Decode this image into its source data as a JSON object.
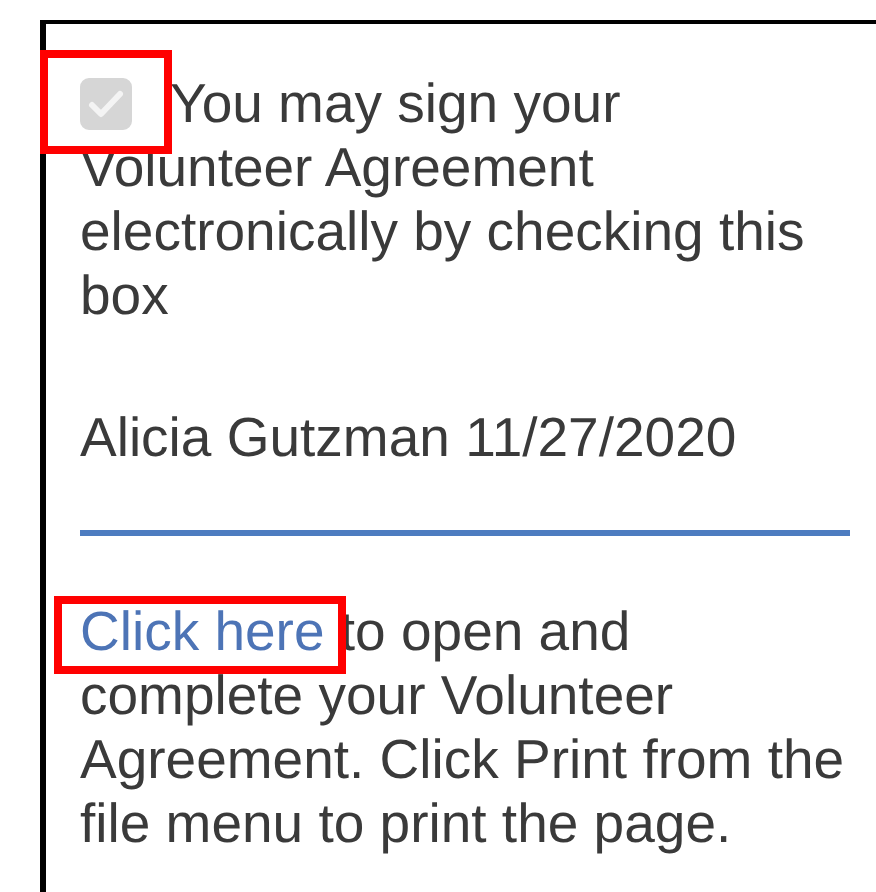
{
  "consent": {
    "checked": true,
    "disabled": true,
    "highlighted": true,
    "label": "You may sign your Volunteer Agreement electronically by checking this box"
  },
  "signature": "Alicia Gutzman 11/27/2020",
  "instructions": {
    "link": {
      "text": "Click here",
      "highlighted": true
    },
    "text": " to open and complete your Volunteer Agreement. Click Print from the file menu to print the page."
  }
}
